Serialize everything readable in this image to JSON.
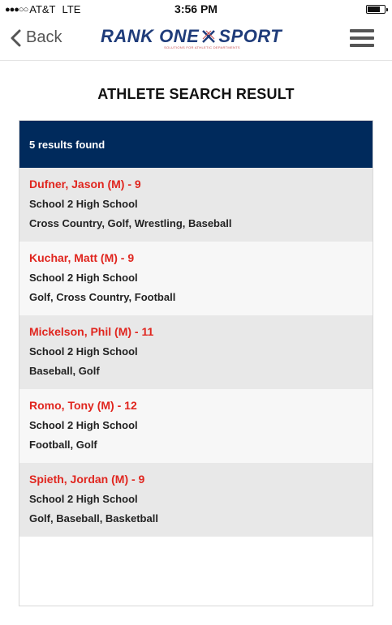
{
  "status_bar": {
    "signal": "●●●○○",
    "carrier": "AT&T",
    "network": "LTE",
    "time": "3:56 PM",
    "battery_level": 0.75
  },
  "nav": {
    "back_label": "Back",
    "logo": {
      "part1": "RANK ONE",
      "part2": "SPORT",
      "tagline": "SOLUTIONS FOR ATHLETIC DEPARTMENTS"
    },
    "brand_color": "#1f3c7a",
    "menu_icon": "hamburger-icon",
    "back_icon": "chevron-left-icon"
  },
  "page_title": "ATHLETE SEARCH RESULT",
  "results": {
    "summary": "5 results found",
    "header_color": "#002a5c",
    "name_color": "#e0261f",
    "items": [
      {
        "name": "Dufner, Jason (M) - 9",
        "school": "School 2 High School",
        "sports": "Cross Country, Golf, Wrestling, Baseball"
      },
      {
        "name": "Kuchar, Matt (M) - 9",
        "school": "School 2 High School",
        "sports": "Golf, Cross Country, Football"
      },
      {
        "name": "Mickelson, Phil (M) - 11",
        "school": "School 2 High School",
        "sports": "Baseball, Golf"
      },
      {
        "name": "Romo, Tony (M) - 12",
        "school": "School 2 High School",
        "sports": "Football, Golf"
      },
      {
        "name": "Spieth, Jordan (M) - 9",
        "school": "School 2 High School",
        "sports": "Golf, Baseball, Basketball"
      }
    ]
  }
}
